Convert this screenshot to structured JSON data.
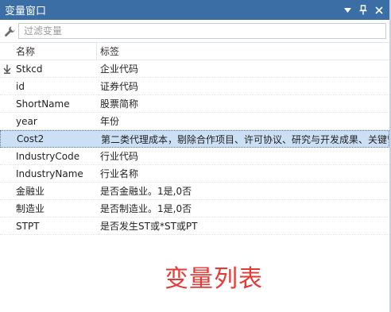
{
  "window": {
    "title": "变量窗口"
  },
  "filter": {
    "placeholder": "过滤变量"
  },
  "columns": {
    "name": "名称",
    "label": "标签"
  },
  "rows": [
    {
      "name": "Stkcd",
      "label": "企业代码",
      "marked": true
    },
    {
      "name": "id",
      "label": "证券代码"
    },
    {
      "name": "ShortName",
      "label": "股票简称"
    },
    {
      "name": "year",
      "label": "年份"
    },
    {
      "name": "Cost2",
      "label": "第二类代理成本，剔除合作项目、许可协议、研究与开发成果、关键管",
      "selected": true
    },
    {
      "name": "IndustryCode",
      "label": "行业代码"
    },
    {
      "name": "IndustryName",
      "label": "行业名称"
    },
    {
      "name": "金融业",
      "label": "是否金融业。1是,0否"
    },
    {
      "name": "制造业",
      "label": "是否制造业。1是,0否"
    },
    {
      "name": "STPT",
      "label": "是否发生ST或*ST或PT"
    }
  ],
  "caption": "变量列表",
  "colors": {
    "titlebar": "#3a6ea5",
    "selected_row": "#cce0f5",
    "caption": "#e53935"
  }
}
